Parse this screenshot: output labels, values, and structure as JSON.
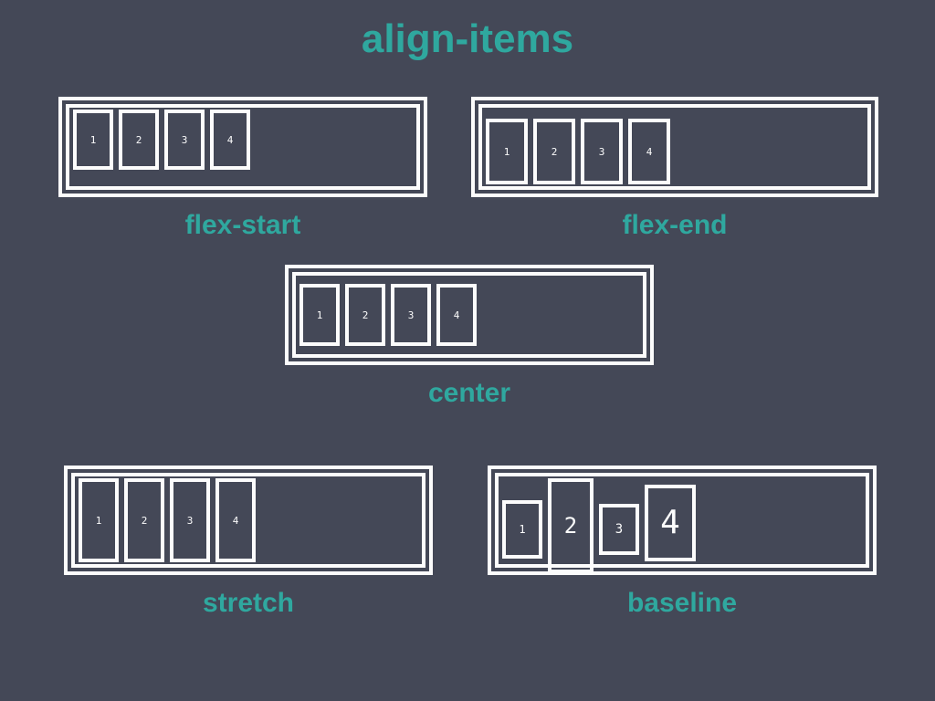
{
  "title": "align-items",
  "colors": {
    "bg": "#444857",
    "accent": "#2fa89f",
    "stroke": "#fcfcfc"
  },
  "demos": {
    "flex_start": {
      "label": "flex-start",
      "items": [
        "1",
        "2",
        "3",
        "4"
      ]
    },
    "flex_end": {
      "label": "flex-end",
      "items": [
        "1",
        "2",
        "3",
        "4"
      ]
    },
    "center": {
      "label": "center",
      "items": [
        "1",
        "2",
        "3",
        "4"
      ]
    },
    "stretch": {
      "label": "stretch",
      "items": [
        "1",
        "2",
        "3",
        "4"
      ]
    },
    "baseline": {
      "label": "baseline",
      "items": [
        "1",
        "2",
        "3",
        "4"
      ]
    }
  }
}
